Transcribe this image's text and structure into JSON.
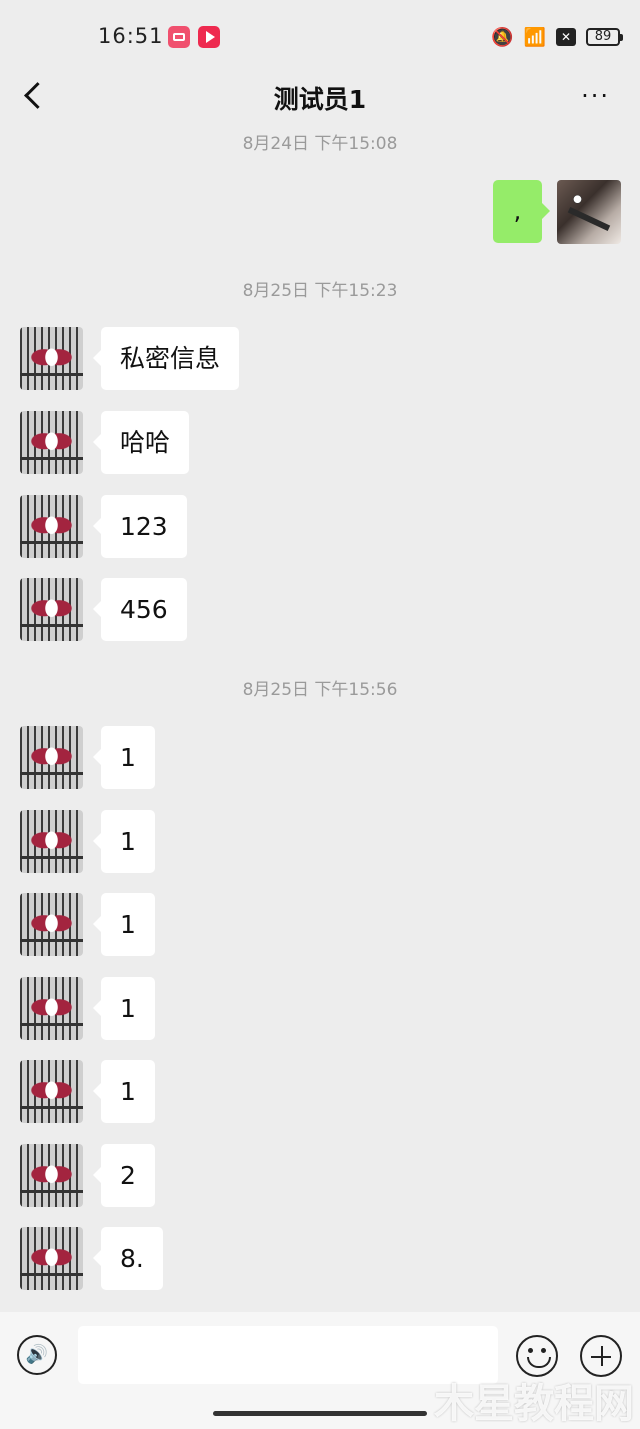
{
  "status_bar": {
    "time": "16:51",
    "battery": "89"
  },
  "nav": {
    "title": "测试员1",
    "more": "···"
  },
  "conversation": {
    "timestamps": [
      "8月24日 下午15:08",
      "8月25日 下午15:23",
      "8月25日 下午15:56"
    ],
    "outgoing": [
      ",",
      ""
    ],
    "messages": [
      "私密信息",
      "哈哈",
      "123",
      "456",
      "1",
      "1",
      "1",
      "1",
      "1",
      "2",
      "8."
    ]
  },
  "input_bar": {
    "placeholder": ""
  },
  "watermark": "木星教程网"
}
